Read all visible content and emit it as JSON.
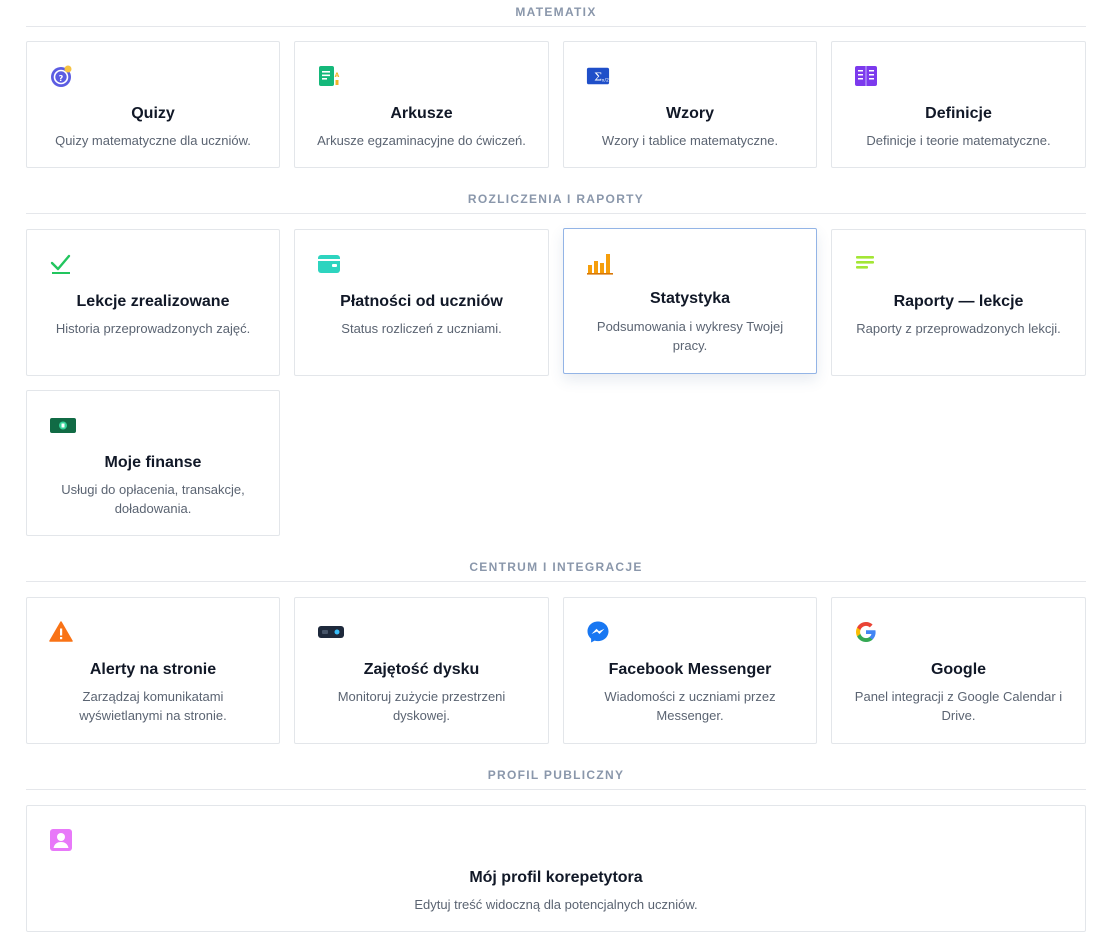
{
  "sections": {
    "matematix": "MATEMATIX",
    "rozliczenia": "ROZLICZENIA I RAPORTY",
    "centrum": "CENTRUM I INTEGRACJE",
    "profil": "PROFIL PUBLICZNY"
  },
  "cards": {
    "quizy": {
      "title": "Quizy",
      "desc": "Quizy matematyczne dla uczniów.",
      "icon": "quiz-icon"
    },
    "arkusze": {
      "title": "Arkusze",
      "desc": "Arkusze egzaminacyjne do ćwiczeń.",
      "icon": "worksheet-icon"
    },
    "wzory": {
      "title": "Wzory",
      "desc": "Wzory i tablice matematyczne.",
      "icon": "formula-icon"
    },
    "definicje": {
      "title": "Definicje",
      "desc": "Definicje i teorie matematyczne.",
      "icon": "book-icon"
    },
    "lekcje": {
      "title": "Lekcje zrealizowane",
      "desc": "Historia przeprowadzonych zajęć.",
      "icon": "checkmark-icon"
    },
    "platnosci": {
      "title": "Płatności od uczniów",
      "desc": "Status rozliczeń z uczniami.",
      "icon": "wallet-icon"
    },
    "statystyka": {
      "title": "Statystyka",
      "desc": "Podsumowania i wykresy Twojej pracy.",
      "icon": "bar-chart-icon"
    },
    "raporty": {
      "title": "Raporty — lekcje",
      "desc": "Raporty z przeprowadzonych lekcji.",
      "icon": "lines-icon"
    },
    "finanse": {
      "title": "Moje finanse",
      "desc": "Usługi do opłacenia, transakcje, doładowania.",
      "icon": "money-icon"
    },
    "alerty": {
      "title": "Alerty na stronie",
      "desc": "Zarządzaj komunikatami wyświetlanymi na stronie.",
      "icon": "warning-icon"
    },
    "dysk": {
      "title": "Zajętość dysku",
      "desc": "Monitoruj zużycie przestrzeni dyskowej.",
      "icon": "disk-icon"
    },
    "messenger": {
      "title": "Facebook Messenger",
      "desc": "Wiadomości z uczniami przez Messenger.",
      "icon": "messenger-icon"
    },
    "google": {
      "title": "Google",
      "desc": "Panel integracji z Google Calendar i Drive.",
      "icon": "google-icon"
    },
    "profil": {
      "title": "Mój profil korepetytora",
      "desc": "Edytuj treść widoczną dla potencjalnych uczniów.",
      "icon": "profile-icon"
    }
  },
  "colors": {
    "section_header": "#8a97ab",
    "card_border": "#e3e6ea",
    "highlight_border": "#93b4e6"
  }
}
